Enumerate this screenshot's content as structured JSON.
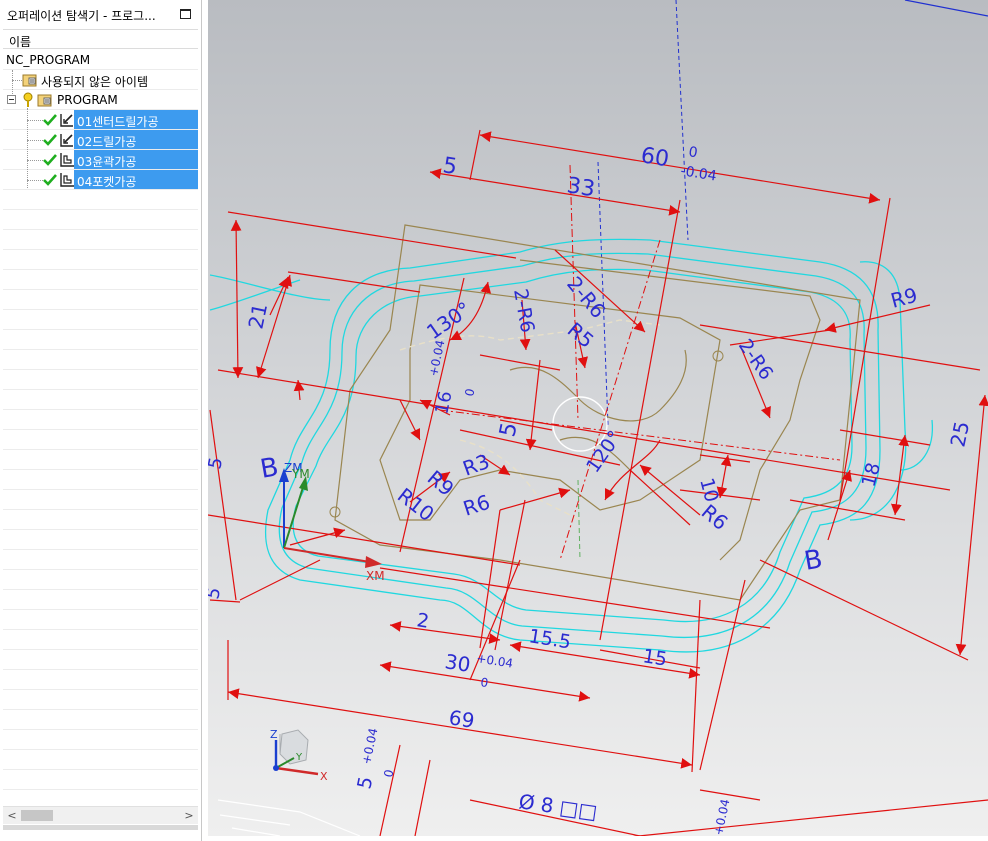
{
  "navigator": {
    "title": "오퍼레이션 탐색기 - 프로그...",
    "column_name": "이름",
    "root": "NC_PROGRAM",
    "items": [
      {
        "label": "사용되지 않은 아이템",
        "icon": "folder-icon",
        "selected": false
      },
      {
        "label": "PROGRAM",
        "icon": "program-group-icon",
        "selected": false
      },
      {
        "label": "01센터드릴가공",
        "icon": "spot-drill-op-icon",
        "status": "complete-check",
        "selected": true
      },
      {
        "label": "02드릴가공",
        "icon": "drill-op-icon",
        "status": "complete-check",
        "selected": true
      },
      {
        "label": "03윤곽가공",
        "icon": "contour-op-icon",
        "status": "complete-check",
        "selected": true
      },
      {
        "label": "04포켓가공",
        "icon": "pocket-op-icon",
        "status": "complete-check",
        "selected": true
      }
    ]
  },
  "viewport": {
    "dimensions": {
      "d60": "60",
      "d60_tol_upper": "0",
      "d60_tol_lower": "-0.04",
      "d5": "5",
      "d33": "33",
      "d2r6_top": "2-R6",
      "d2r6_left": "2-R6",
      "d2r6_right": "2-R6",
      "r5": "R5",
      "r9": "R9",
      "a130": "130°",
      "d21": "21",
      "d16": "16",
      "d16_tol": "+0.04",
      "d16_tol0": "0",
      "d5b": "5",
      "r3": "R3",
      "r9b": "R9",
      "a120": "120°",
      "d10": "10",
      "d18": "18",
      "d25": "25",
      "r10": "R10",
      "r6a": "R6",
      "r6b": "R6",
      "sec_b1": "B",
      "sec_b2": "B",
      "d2": "2",
      "d155": "15.5",
      "d15": "15",
      "d30": "30",
      "d30_tol": "+0.04",
      "d30_tol0": "0",
      "d69": "69",
      "d5c": "5",
      "d5c_tol": "+0.04",
      "d5c_tol0": "0",
      "phi8": "Ø 8 □□",
      "tol_br": "+0.04",
      "d5_left": "5",
      "left_5": "5"
    },
    "axes": {
      "zm": "ZM",
      "ym": "YM",
      "xm": "XM",
      "z": "Z",
      "y": "Y",
      "x": "X"
    },
    "colors": {
      "dimension_red": "#e01010",
      "text_blue": "#2b2bd0",
      "toolpath_cyan": "#20d8e0",
      "part_tan": "#9a8650",
      "selection": "#3d9bef"
    }
  }
}
